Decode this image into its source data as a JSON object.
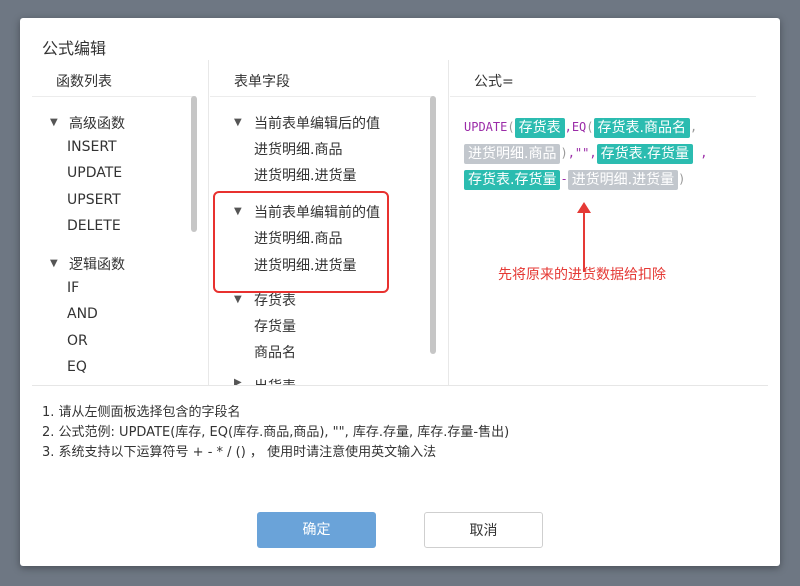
{
  "dialog": {
    "title": "公式编辑"
  },
  "functions": {
    "header": "函数列表",
    "groups": [
      {
        "label": "高级函数",
        "items": [
          "INSERT",
          "UPDATE",
          "UPSERT",
          "DELETE"
        ]
      },
      {
        "label": "逻辑函数",
        "items": [
          "IF",
          "AND",
          "OR",
          "EQ"
        ]
      }
    ]
  },
  "fields": {
    "header": "表单字段",
    "groups": [
      {
        "label": "当前表单编辑后的值",
        "items": [
          "进货明细.商品",
          "进货明细.进货量"
        ]
      },
      {
        "label": "当前表单编辑前的值",
        "items": [
          "进货明细.商品",
          "进货明细.进货量"
        ]
      },
      {
        "label": "存货表",
        "items": [
          "存货量",
          "商品名"
        ]
      },
      {
        "label": "出货表",
        "items": []
      }
    ]
  },
  "formula": {
    "header": "公式=",
    "update": "UPDATE",
    "open1": "(",
    "t1": "存货表",
    "comma1": ",",
    "eq": "EQ",
    "open2": "(",
    "t2": "存货表.商品名",
    "comma2": ",",
    "t3": "进货明细.商品",
    "close2": ")",
    "comma3": ",",
    "empty_str": "\"\"",
    "comma4": ",",
    "t4": "存货表.存货量",
    "comma5": ",",
    "t5": "存货表.存货量",
    "minus": "-",
    "t6": "进货明细.进货量",
    "close1": ")"
  },
  "annotation": "先将原来的进货数据给扣除",
  "hints": [
    "1. 请从左侧面板选择包含的字段名",
    "2. 公式范例: UPDATE(库存, EQ(库存.商品,商品), \"\", 库存.存量, 库存.存量-售出)",
    "3. 系统支持以下运算符号 + - * / () ， 使用时请注意使用英文输入法"
  ],
  "buttons": {
    "ok": "确定",
    "cancel": "取消"
  },
  "colors": {
    "tag_teal": "#2bbcb0",
    "tag_grey": "#c2c7cd",
    "annotation_red": "#e53935",
    "ok_blue": "#6aa3d9"
  }
}
